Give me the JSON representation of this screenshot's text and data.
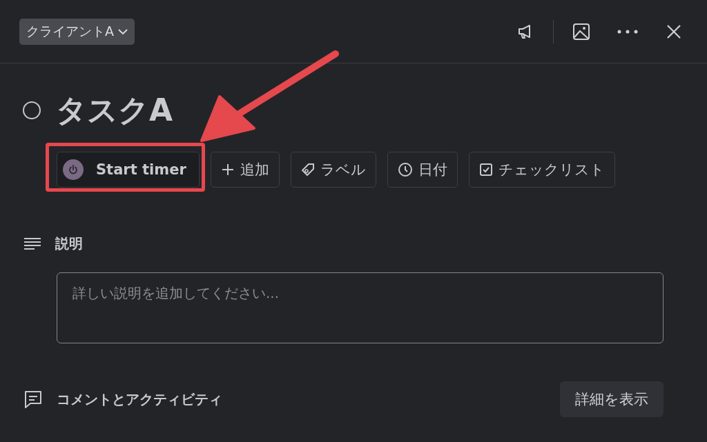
{
  "header": {
    "list_chip": "クライアントA"
  },
  "task": {
    "title": "タスクA",
    "completed": false
  },
  "actions": [
    {
      "kind": "timer",
      "label": "Start timer",
      "highlighted": true
    },
    {
      "kind": "add",
      "label": "追加",
      "highlighted": false
    },
    {
      "kind": "label",
      "label": "ラベル",
      "highlighted": false
    },
    {
      "kind": "date",
      "label": "日付",
      "highlighted": false
    },
    {
      "kind": "checklist",
      "label": "チェックリスト",
      "highlighted": false
    }
  ],
  "description": {
    "heading": "説明",
    "placeholder": "詳しい説明を追加してください..."
  },
  "activity": {
    "heading": "コメントとアクティビティ",
    "button": "詳細を表示"
  }
}
